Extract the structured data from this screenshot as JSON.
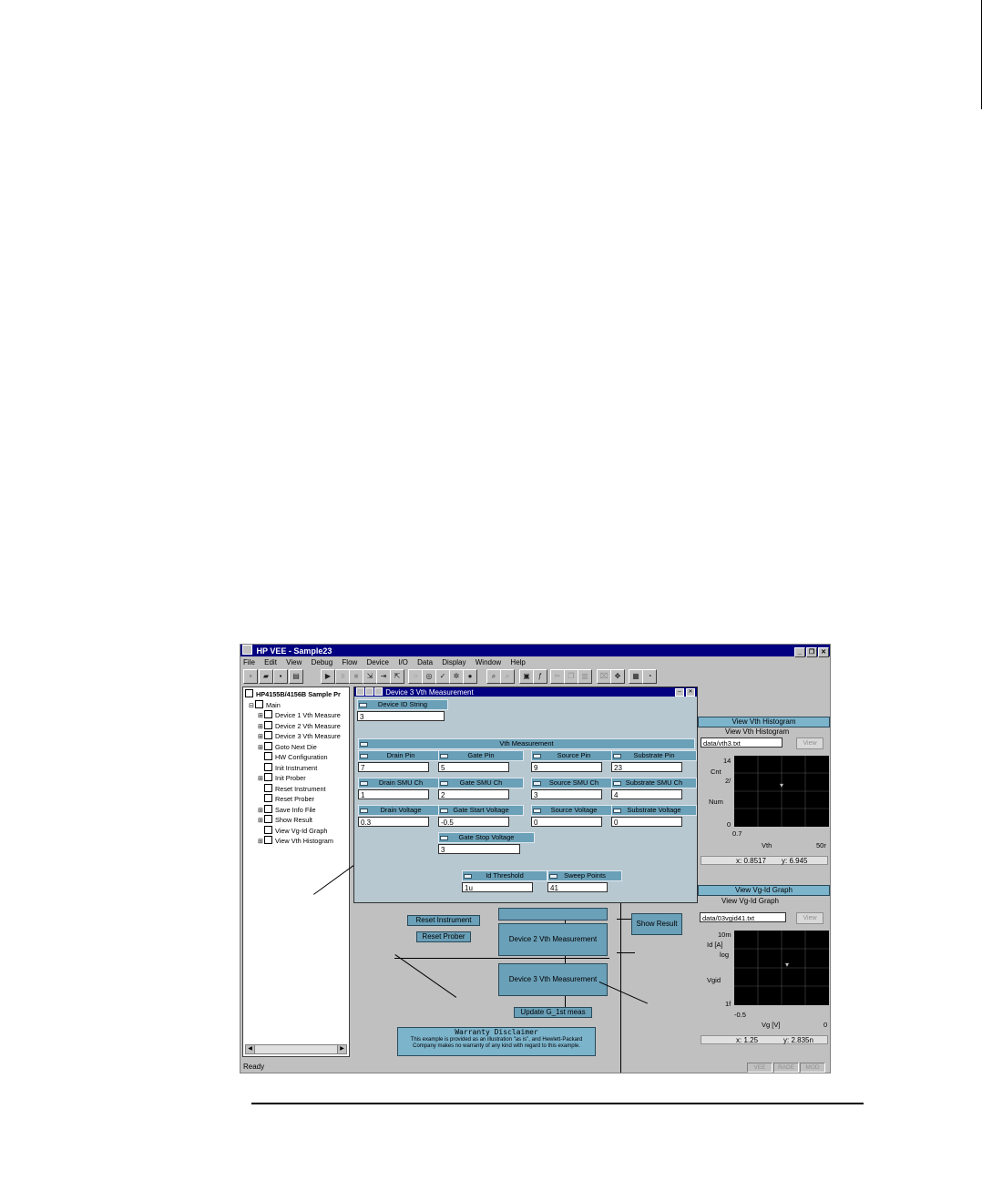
{
  "window": {
    "title": "HP VEE - Sample23",
    "controls": [
      "_",
      "❐",
      "✕"
    ]
  },
  "menu": [
    "File",
    "Edit",
    "View",
    "Debug",
    "Flow",
    "Device",
    "I/O",
    "Data",
    "Display",
    "Window",
    "Help"
  ],
  "tree": {
    "root": "HP4155B/4156B Sample Pr",
    "main": "Main",
    "items": [
      {
        "label": "Device 1 Vth Measure",
        "expand": "+"
      },
      {
        "label": "Device 2 Vth Measure",
        "expand": "+"
      },
      {
        "label": "Device 3 Vth Measure",
        "expand": "+"
      },
      {
        "label": "Goto Next Die",
        "expand": "+"
      },
      {
        "label": "HW Configuration",
        "expand": ""
      },
      {
        "label": "Init Instrument",
        "expand": ""
      },
      {
        "label": "Init Prober",
        "expand": "+"
      },
      {
        "label": "Reset Instrument",
        "expand": ""
      },
      {
        "label": "Reset Prober",
        "expand": ""
      },
      {
        "label": "Save Info File",
        "expand": "+"
      },
      {
        "label": "Show Result",
        "expand": "+"
      },
      {
        "label": "View Vg-Id Graph",
        "expand": ""
      },
      {
        "label": "View Vth Histogram",
        "expand": "+"
      }
    ]
  },
  "popup": {
    "title": "Device 3 Vth Measurement",
    "device_id": {
      "label": "Device ID String",
      "value": "3"
    },
    "section": "Vth Measurement",
    "fields": [
      {
        "label": "Drain Pin",
        "value": "7"
      },
      {
        "label": "Gate Pin",
        "value": "5"
      },
      {
        "label": "Source Pin",
        "value": "9"
      },
      {
        "label": "Substrate Pin",
        "value": "23"
      },
      {
        "label": "Drain SMU Ch",
        "value": "1"
      },
      {
        "label": "Gate SMU Ch",
        "value": "2"
      },
      {
        "label": "Source SMU Ch",
        "value": "3"
      },
      {
        "label": "Substrate SMU Ch",
        "value": "4"
      },
      {
        "label": "Drain Voltage",
        "value": "0.3"
      },
      {
        "label": "Gate Start Voltage",
        "value": "-0.5"
      },
      {
        "label": "Source Voltage",
        "value": "0"
      },
      {
        "label": "Substrate Voltage",
        "value": "0"
      },
      {
        "label": "Gate Stop Voltage",
        "value": "3"
      },
      {
        "label": "Id Threshold",
        "value": "1u"
      },
      {
        "label": "Sweep Points",
        "value": "41"
      }
    ]
  },
  "canvas": {
    "reset_instrument": "Reset Instrument",
    "reset_prober": "Reset Prober",
    "device2": "Device 2 Vth Measurement",
    "device3": "Device 3 Vth Measurement",
    "show_result": "Show Result",
    "update": "Update G_1st meas",
    "disclaimer_title": "Warranty Disclaimer",
    "disclaimer_text": "This example is provided as an illustration \"as is\", and Hewlett-Packard Company makes no warranty of any kind with regard to this example."
  },
  "histogram": {
    "band": "View Vth Histogram",
    "title": "View Vth Histogram",
    "file": "data/vth3.txt",
    "view_button": "View",
    "y_top": "14",
    "y_mid": "2/",
    "y_label_1": "Cnt",
    "y_label_2": "Num",
    "y_bottom": "0",
    "x_left": "0.7",
    "x_label": "Vth",
    "x_right": "50r",
    "readout_x": "x: 0.8517",
    "readout_y": "y: 6.945"
  },
  "vgid": {
    "band": "View Vg-Id Graph",
    "title": "View Vg-Id Graph",
    "file": "data/03vgid41.txt",
    "view_button": "View",
    "y_top": "10m",
    "y_label_1": "Id [A]",
    "y_label_2": "log",
    "y_label_3": "Vgid",
    "y_bottom": "1f",
    "x_left": "-0.5",
    "x_label": "Vg [V]",
    "x_right": "0",
    "readout_x": "x: 1.25",
    "readout_y": "y: 2.835n"
  },
  "status": {
    "text": "Ready",
    "panels": [
      "VEE",
      "RADE",
      "MOD"
    ]
  }
}
